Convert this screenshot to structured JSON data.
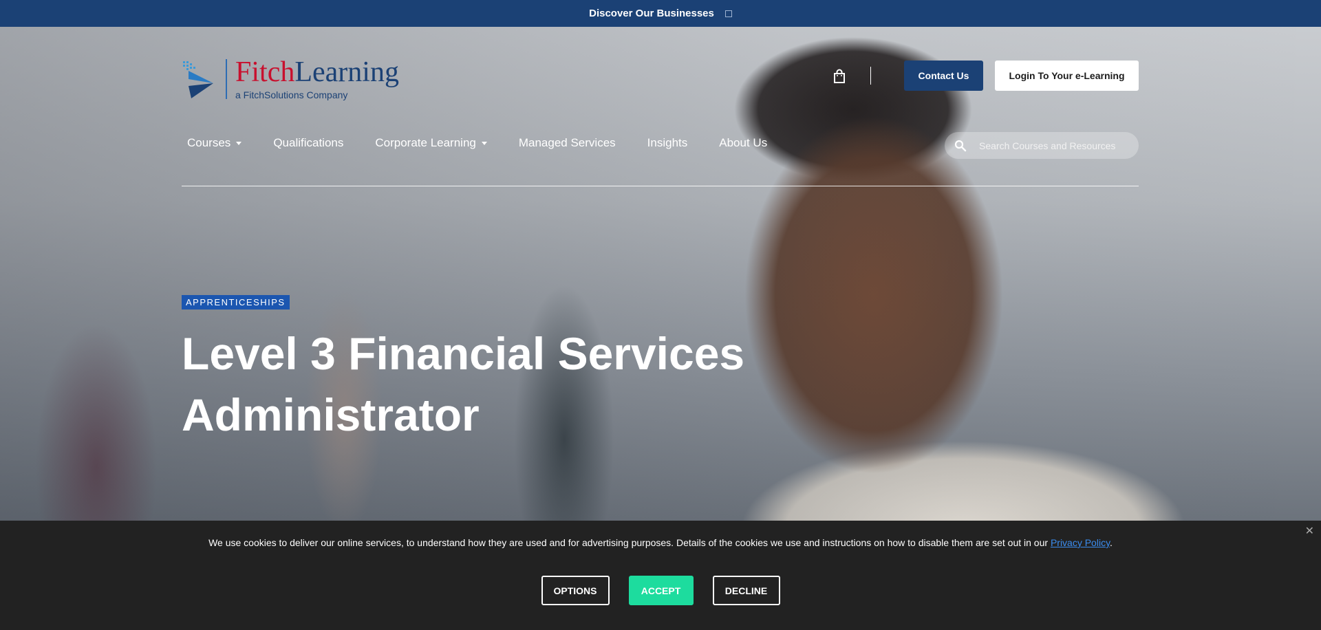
{
  "topbar": {
    "label": "Discover Our Businesses"
  },
  "logo": {
    "brand_part1": "Fitch",
    "brand_part2": "Learning",
    "tagline": "a FitchSolutions Company"
  },
  "header": {
    "contact_label": "Contact Us",
    "login_label": "Login To Your e-Learning"
  },
  "nav": {
    "items": [
      {
        "label": "Courses",
        "has_dropdown": true
      },
      {
        "label": "Qualifications",
        "has_dropdown": false
      },
      {
        "label": "Corporate Learning",
        "has_dropdown": true
      },
      {
        "label": "Managed Services",
        "has_dropdown": false
      },
      {
        "label": "Insights",
        "has_dropdown": false
      },
      {
        "label": "About Us",
        "has_dropdown": false
      }
    ]
  },
  "search": {
    "placeholder": "Search Courses and Resources"
  },
  "hero": {
    "badge": "APPRENTICESHIPS",
    "title_line1": "Level 3 Financial Services",
    "title_line2": "Administrator"
  },
  "cookie": {
    "text": "We use cookies to deliver our online services, to understand how they are used and for advertising purposes. Details of the cookies we use and instructions on how to disable them are set out in our",
    "link_label": "Privacy Policy",
    "text_end": ".",
    "options_label": "OPTIONS",
    "accept_label": "ACCEPT",
    "decline_label": "DECLINE",
    "close_glyph": "✕"
  },
  "colors": {
    "brand_navy": "#1b4175",
    "brand_red": "#c8102e",
    "accept_green": "#1ddc9e",
    "badge_blue": "#1b56b0"
  },
  "icons": [
    "bag-icon",
    "search-icon",
    "close-icon",
    "chevron-down-icon",
    "fitch-logo-icon"
  ]
}
